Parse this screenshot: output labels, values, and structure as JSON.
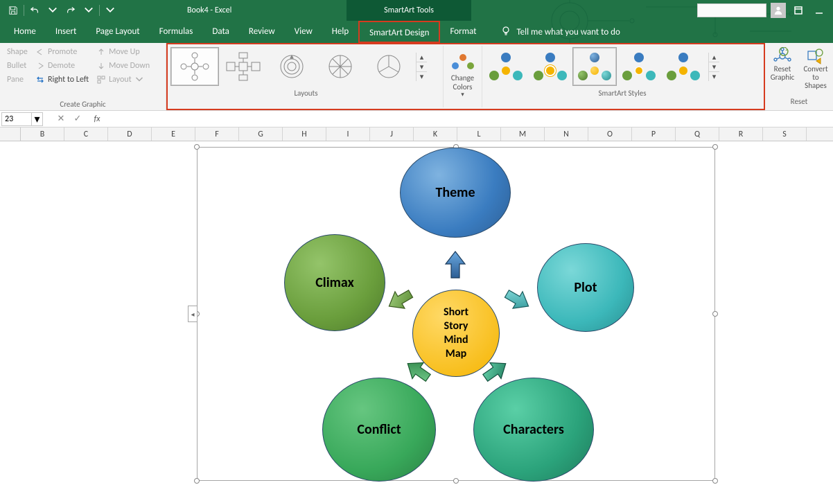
{
  "titlebar": {
    "doc_title": "Book4 - Excel",
    "context_tool": "SmartArt Tools"
  },
  "tabs": {
    "home": "Home",
    "insert": "Insert",
    "page_layout": "Page Layout",
    "formulas": "Formulas",
    "data": "Data",
    "review": "Review",
    "view": "View",
    "help": "Help",
    "smartart_design": "SmartArt Design",
    "format": "Format",
    "tell_me": "Tell me what you want to do"
  },
  "ribbon": {
    "create_graphic": {
      "shape": "Shape",
      "bullet": "Bullet",
      "pane": "Pane",
      "promote": "Promote",
      "demote": "Demote",
      "right_to_left": "Right to Left",
      "move_up": "Move Up",
      "move_down": "Move Down",
      "layout": "Layout",
      "label": "Create Graphic"
    },
    "layouts": {
      "label": "Layouts"
    },
    "change_colors": "Change Colors",
    "styles": {
      "label": "SmartArt Styles"
    },
    "reset": {
      "reset_graphic": "Reset Graphic",
      "convert_to_shapes": "Convert to Shapes",
      "label": "Reset"
    }
  },
  "formula_bar": {
    "name_box": "23"
  },
  "columns": [
    "B",
    "C",
    "D",
    "E",
    "F",
    "G",
    "H",
    "I",
    "J",
    "K",
    "L",
    "M",
    "N",
    "O",
    "P",
    "Q",
    "R",
    "S"
  ],
  "smartart": {
    "center": "Short Story Mind Map",
    "theme": "Theme",
    "climax": "Climax",
    "plot": "Plot",
    "conflict": "Conflict",
    "characters": "Characters"
  }
}
